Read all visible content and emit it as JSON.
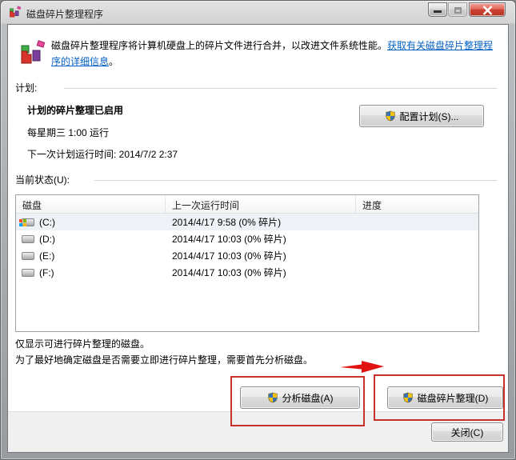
{
  "window": {
    "title": "磁盘碎片整理程序"
  },
  "intro": {
    "text": "磁盘碎片整理程序将计算机硬盘上的碎片文件进行合并，以改进文件系统性能。",
    "link": "获取有关磁盘碎片整理程序的详细信息",
    "link_suffix": "。"
  },
  "schedule": {
    "heading": "计划:",
    "status": "计划的碎片整理已启用",
    "frequency": "每星期三 1:00 运行",
    "next_run": "下一次计划运行时间: 2014/7/2 2:37",
    "configure_button": "配置计划(S)..."
  },
  "status_section": {
    "heading": "当前状态(U):",
    "table": {
      "columns": [
        "磁盘",
        "上一次运行时间",
        "进度"
      ],
      "rows": [
        {
          "disk": "(C:)",
          "last_run": "2014/4/17 9:58 (0% 碎片)",
          "progress": "",
          "icon": "system-drive-icon",
          "selected": true
        },
        {
          "disk": "(D:)",
          "last_run": "2014/4/17 10:03 (0% 碎片)",
          "progress": "",
          "icon": "drive-icon",
          "selected": false
        },
        {
          "disk": "(E:)",
          "last_run": "2014/4/17 10:03 (0% 碎片)",
          "progress": "",
          "icon": "drive-icon",
          "selected": false
        },
        {
          "disk": "(F:)",
          "last_run": "2014/4/17 10:03 (0% 碎片)",
          "progress": "",
          "icon": "drive-icon",
          "selected": false
        }
      ]
    }
  },
  "notes": {
    "line1": "仅显示可进行碎片整理的磁盘。",
    "line2": "为了最好地确定磁盘是否需要立即进行碎片整理，需要首先分析磁盘。"
  },
  "actions": {
    "analyze_button": "分析磁盘(A)",
    "defragment_button": "磁盘碎片整理(D)",
    "close_button": "关闭(C)"
  },
  "colors": {
    "annotation_red": "#c8302a",
    "arrow_red": "#e01212",
    "link_blue": "#0661c4",
    "selected_row": "#eef2f7",
    "close_button_red": "#cc4231"
  }
}
